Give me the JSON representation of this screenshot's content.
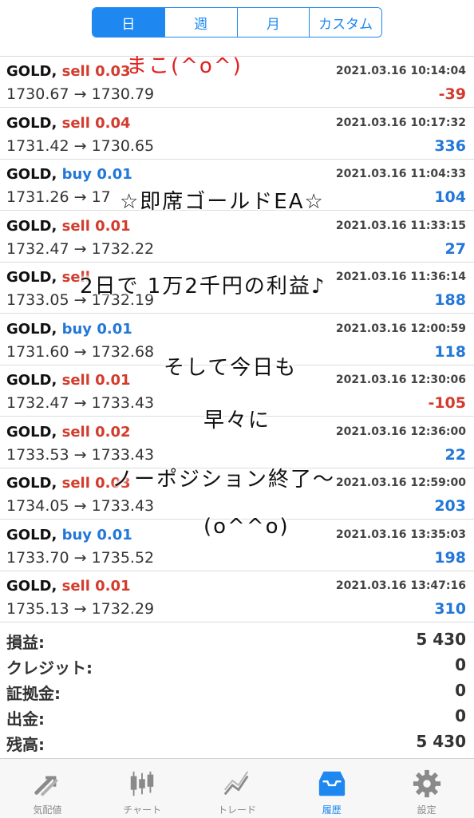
{
  "tabs_top": [
    {
      "label": "日",
      "active": true
    },
    {
      "label": "週",
      "active": false
    },
    {
      "label": "月",
      "active": false
    },
    {
      "label": "カスタム",
      "active": false
    }
  ],
  "trades": [
    {
      "symbol": "GOLD,",
      "dir": "sell",
      "lots": "0.03",
      "time": "2021.03.16 10:14:04",
      "prices": "1730.67 → 1730.79",
      "profit": "-39"
    },
    {
      "symbol": "GOLD,",
      "dir": "sell",
      "lots": "0.04",
      "time": "2021.03.16 10:17:32",
      "prices": "1731.42 → 1730.65",
      "profit": "336"
    },
    {
      "symbol": "GOLD,",
      "dir": "buy",
      "lots": "0.01",
      "time": "2021.03.16 11:04:33",
      "prices": "1731.26 → 17",
      "profit": "104"
    },
    {
      "symbol": "GOLD,",
      "dir": "sell",
      "lots": "0.01",
      "time": "2021.03.16 11:33:15",
      "prices": "1732.47 → 1732.22",
      "profit": "27"
    },
    {
      "symbol": "GOLD,",
      "dir": "sell",
      "lots": "",
      "time": "2021.03.16 11:36:14",
      "prices": "1733.05 → 1732.19",
      "profit": "188"
    },
    {
      "symbol": "GOLD,",
      "dir": "buy",
      "lots": "0.01",
      "time": "2021.03.16 12:00:59",
      "prices": "1731.60 → 1732.68",
      "profit": "118"
    },
    {
      "symbol": "GOLD,",
      "dir": "sell",
      "lots": "0.01",
      "time": "2021.03.16 12:30:06",
      "prices": "1732.47 → 1733.43",
      "profit": "-105"
    },
    {
      "symbol": "GOLD,",
      "dir": "sell",
      "lots": "0.02",
      "time": "2021.03.16 12:36:00",
      "prices": "1733.53 → 1733.43",
      "profit": "22"
    },
    {
      "symbol": "GOLD,",
      "dir": "sell",
      "lots": "0.03",
      "time": "2021.03.16 12:59:00",
      "prices": "1734.05 → 1733.43",
      "profit": "203"
    },
    {
      "symbol": "GOLD,",
      "dir": "buy",
      "lots": "0.01",
      "time": "2021.03.16 13:35:03",
      "prices": "1733.70 → 1735.52",
      "profit": "198"
    },
    {
      "symbol": "GOLD,",
      "dir": "sell",
      "lots": "0.01",
      "time": "2021.03.16 13:47:16",
      "prices": "1735.13 → 1732.29",
      "profit": "310"
    }
  ],
  "summary": [
    {
      "label": "損益:",
      "value": "5 430"
    },
    {
      "label": "クレジット:",
      "value": "0"
    },
    {
      "label": "証拠金:",
      "value": "0"
    },
    {
      "label": "出金:",
      "value": "0"
    },
    {
      "label": "残高:",
      "value": "5 430"
    }
  ],
  "bottom_tabs": [
    {
      "label": "気配値",
      "icon": "quotes-icon",
      "active": false
    },
    {
      "label": "チャート",
      "icon": "chart-icon",
      "active": false
    },
    {
      "label": "トレード",
      "icon": "trade-icon",
      "active": false
    },
    {
      "label": "履歴",
      "icon": "history-icon",
      "active": true
    },
    {
      "label": "設定",
      "icon": "settings-icon",
      "active": false
    }
  ],
  "overlay": {
    "signature": "まこ(^o^)",
    "line1": "☆即席ゴールドEA☆",
    "line2": "2日で 1万2千円の利益♪",
    "line3": "そして今日も",
    "line4": "早々に",
    "line5": "ノーポジション終了〜",
    "line6": "(o^^o)"
  },
  "colors": {
    "accent": "#1e88f0",
    "sell": "#d33b2c",
    "buy": "#2277d8"
  }
}
